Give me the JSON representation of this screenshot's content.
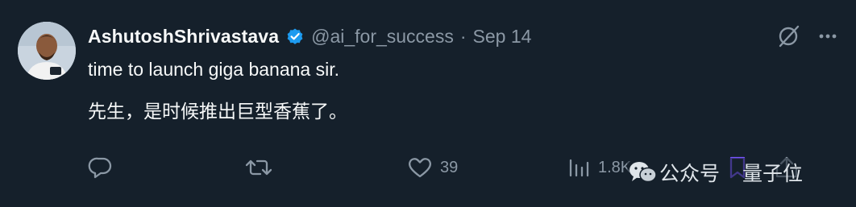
{
  "tweet": {
    "display_name": "AshutoshShrivastava",
    "handle": "@ai_for_success",
    "separator": "·",
    "date": "Sep 14",
    "text_en": "time to launch giga banana sir.",
    "text_zh": "先生，是时候推出巨型香蕉了。"
  },
  "actions": {
    "reply_icon": "reply-icon",
    "retweet_icon": "retweet-icon",
    "like_icon": "heart-icon",
    "like_count": "39",
    "views_icon": "views-icon",
    "views_count": "1.8K",
    "bookmark_icon": "bookmark-icon",
    "share_icon": "share-icon"
  },
  "top_actions": {
    "grok_icon": "grok-icon",
    "more_icon": "more-icon"
  },
  "watermark": {
    "source": "公众号",
    "name": "量子位",
    "icon": "wechat-icon"
  },
  "colors": {
    "background": "#15202b",
    "primary_text": "#f7f9f9",
    "secondary_text": "#8b98a5",
    "verified": "#1d9bf0"
  }
}
